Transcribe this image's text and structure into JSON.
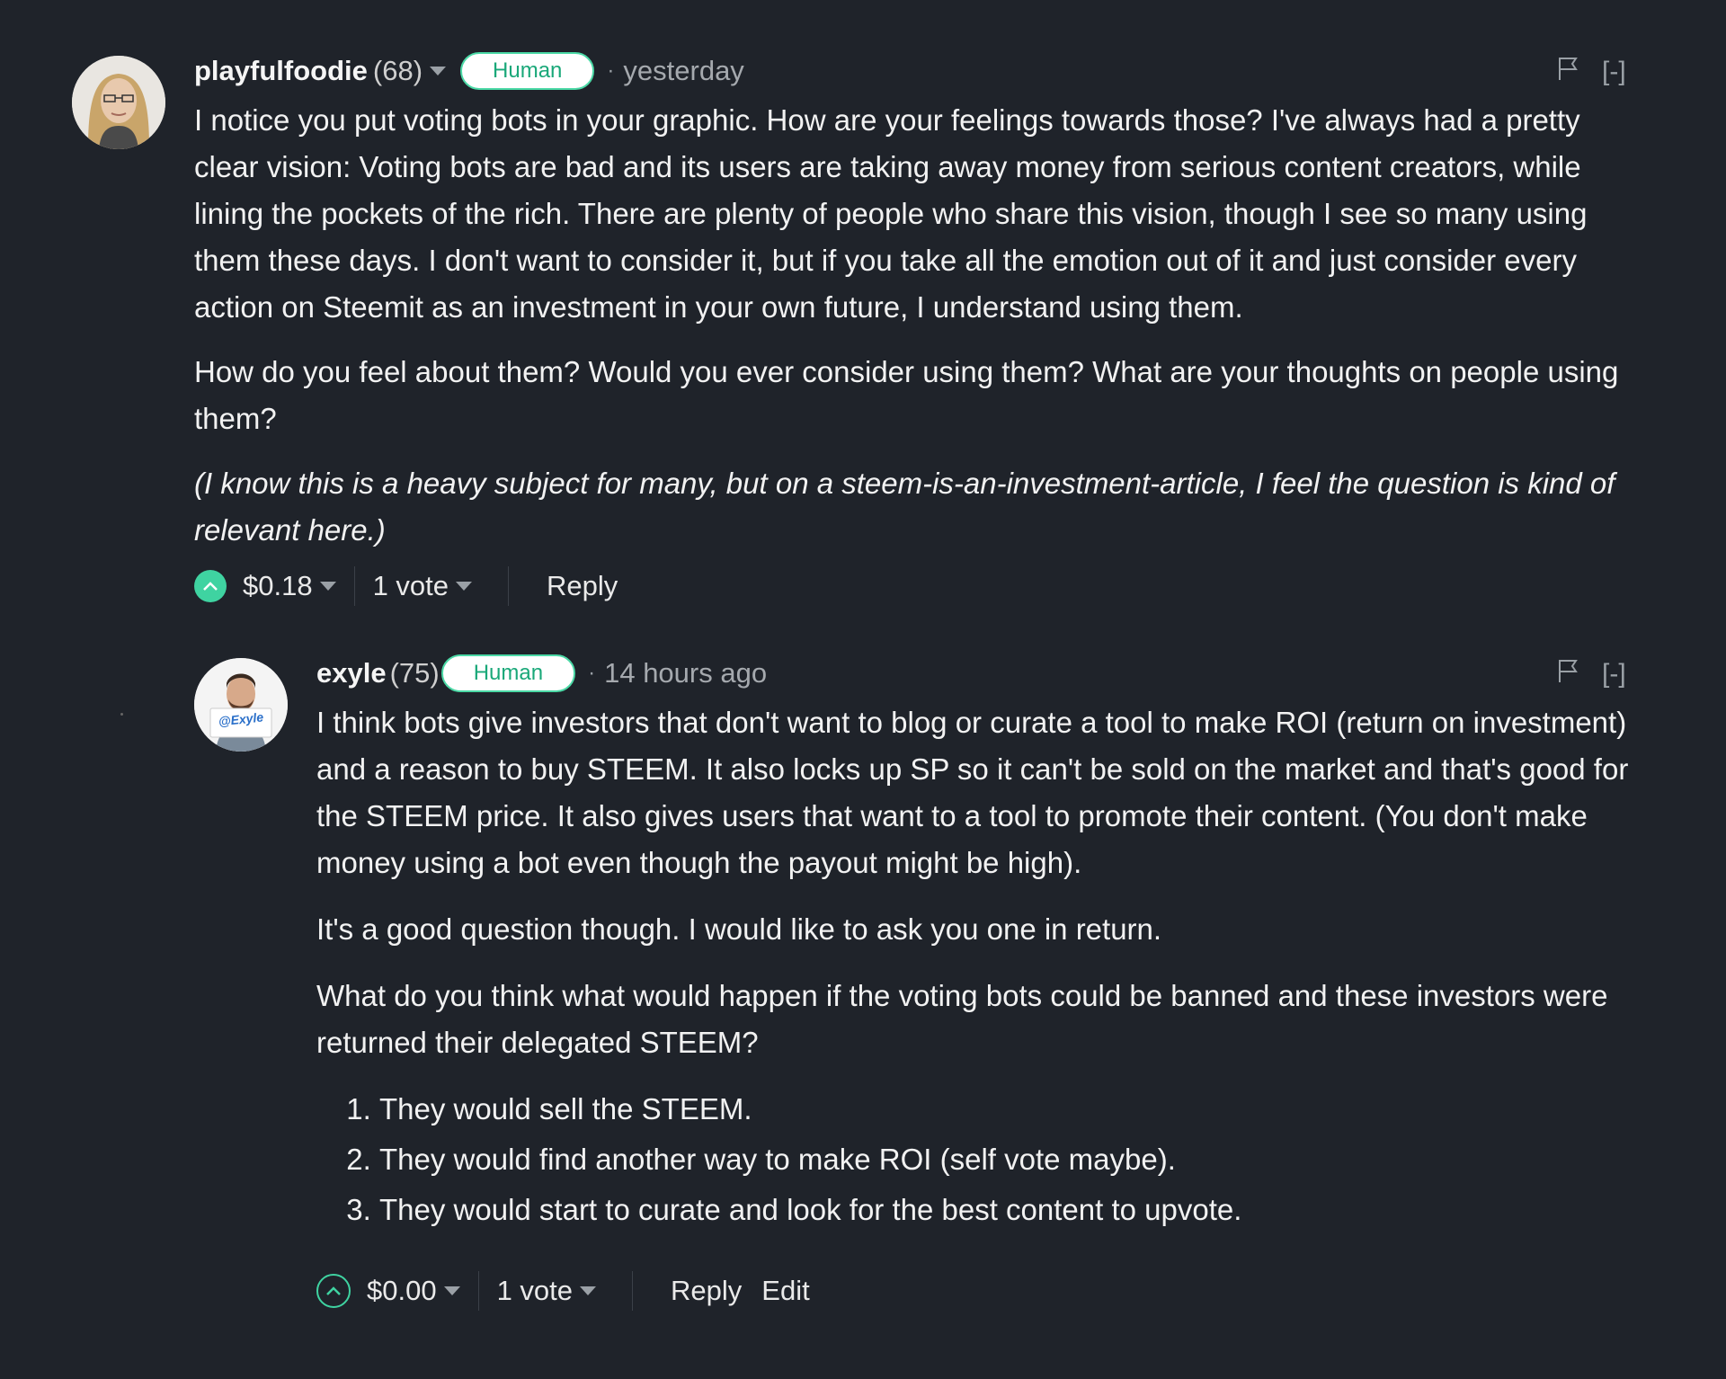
{
  "colors": {
    "background": "#1f232a",
    "accent_green": "#3fd3a1",
    "badge_text": "#1aa879",
    "muted": "#a5a9ae"
  },
  "comments": [
    {
      "author": "playfulfoodie",
      "reputation": "(68)",
      "badge": "Human",
      "separator": "·",
      "time": "yesterday",
      "collapse": "[-]",
      "paragraphs": [
        "I notice you put voting bots in your graphic. How are your feelings towards those? I've always had a pretty clear vision: Voting bots are bad and its users are taking away money from serious content creators, while lining the pockets of the rich. There are plenty of people who share this vision, though I see so many using them these days. I don't want to consider it, but if you take all the emotion out of it and just consider every action on Steemit as an investment in your own future, I understand using them.",
        "How do you feel about them? Would you ever consider using them? What are your thoughts on people using them?"
      ],
      "italic_paragraph": "(I know this is a heavy subject for many, but on a steem-is-an-investment-article, I feel the question is kind of relevant here.)",
      "payout": "$0.18",
      "votes": "1 vote",
      "reply_label": "Reply"
    },
    {
      "author": "exyle",
      "reputation": "(75)",
      "badge": "Human",
      "separator": "·",
      "time": "14 hours ago",
      "collapse": "[-]",
      "avatar_sign_text": "@Exyle",
      "paragraphs": [
        "I think bots give investors that don't want to blog or curate a tool to make ROI (return on investment) and a reason to buy STEEM. It also locks up SP so it can't be sold on the market and that's good for the STEEM price. It also gives users that want to a tool to promote their content. (You don't make money using a bot even though the payout might be high).",
        "It's a good question though. I would like to ask you one in return.",
        "What do you think what would happen if the voting bots could be banned and these investors were returned their delegated STEEM?"
      ],
      "list_items": [
        "They would sell the STEEM.",
        "They would find another way to make ROI (self vote maybe).",
        "They would start to curate and look for the best content to upvote."
      ],
      "payout": "$0.00",
      "votes": "1 vote",
      "reply_label": "Reply",
      "edit_label": "Edit"
    }
  ]
}
